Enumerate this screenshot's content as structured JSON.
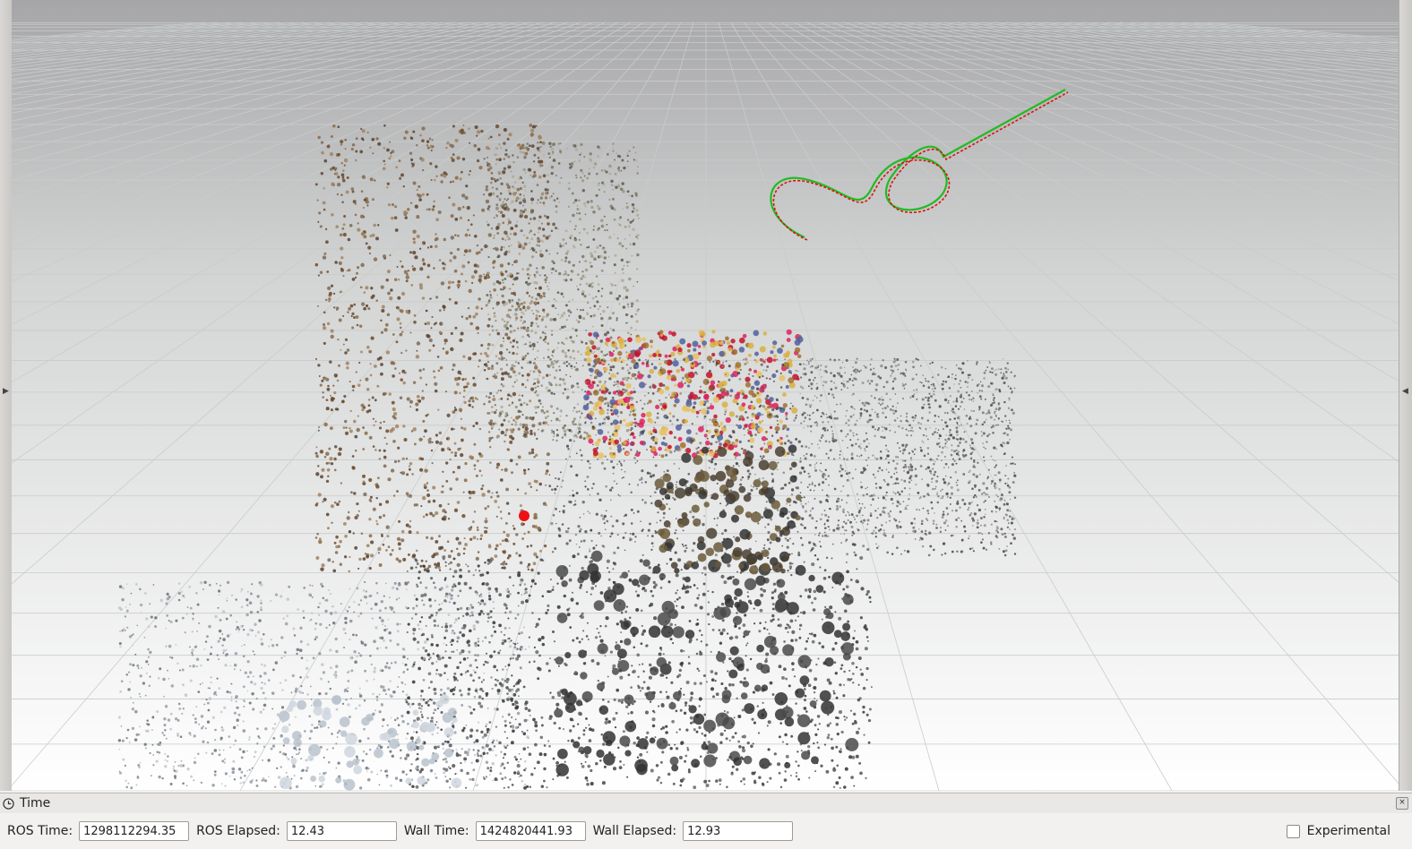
{
  "panel": {
    "title": "Time",
    "close_label": "×"
  },
  "time_bar": {
    "ros_time_label": "ROS Time:",
    "ros_time_value": "1298112294.35",
    "ros_elapsed_label": "ROS Elapsed:",
    "ros_elapsed_value": "12.43",
    "wall_time_label": "Wall Time:",
    "wall_time_value": "1424820441.93",
    "wall_elapsed_label": "Wall Elapsed:",
    "wall_elapsed_value": "12.93",
    "experimental_label": "Experimental",
    "experimental_checked": false
  },
  "viewport": {
    "background_top": "#a6a6a8",
    "background_bottom": "#ffffff",
    "grid_color": "#c9cccc",
    "trajectory_colors": [
      "#22bb22",
      "#dd1111"
    ],
    "marker_color": "#ee1111"
  },
  "icons": {
    "clock": "clock-icon",
    "close": "close-icon",
    "collapse_left": "chevron-left-icon",
    "collapse_right": "chevron-right-icon"
  }
}
